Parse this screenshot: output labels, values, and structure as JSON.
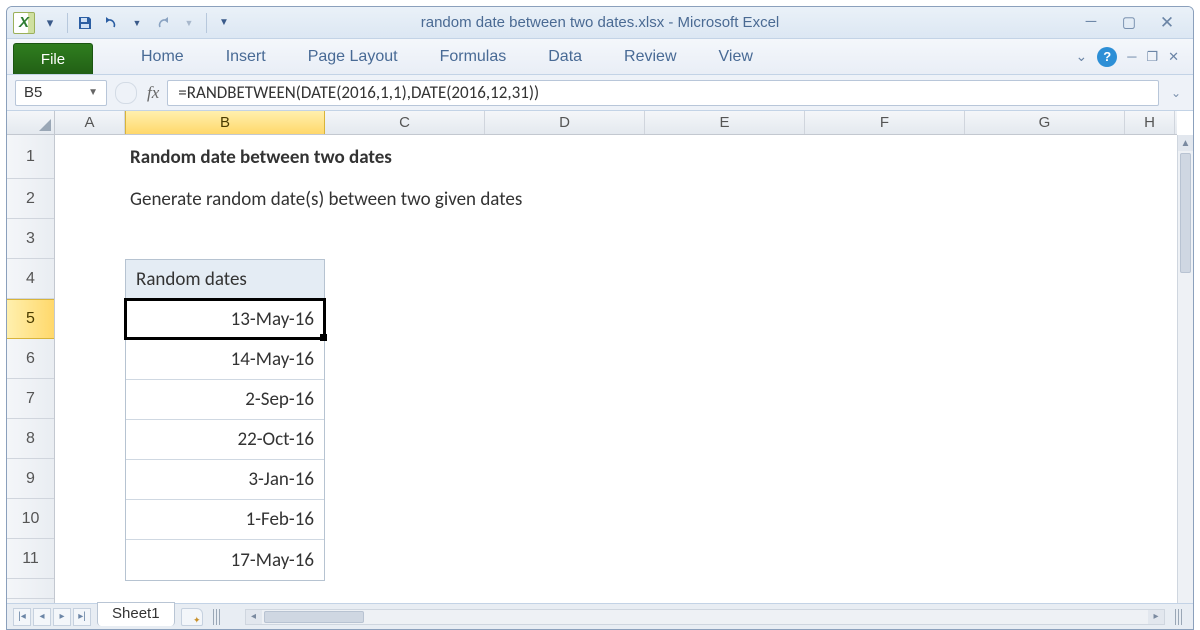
{
  "window": {
    "title": "random date between two dates.xlsx  -  Microsoft Excel"
  },
  "qat": {
    "logo_letter": "X"
  },
  "ribbon": {
    "file": "File",
    "tabs": [
      "Home",
      "Insert",
      "Page Layout",
      "Formulas",
      "Data",
      "Review",
      "View"
    ]
  },
  "name_box": "B5",
  "fx_label": "fx",
  "formula": "=RANDBETWEEN(DATE(2016,1,1),DATE(2016,12,31))",
  "columns": [
    "A",
    "B",
    "C",
    "D",
    "E",
    "F",
    "G",
    "H"
  ],
  "rows": [
    "1",
    "2",
    "3",
    "4",
    "5",
    "6",
    "7",
    "8",
    "9",
    "10",
    "11"
  ],
  "selected_col_index": 1,
  "selected_row_index": 4,
  "content": {
    "title": "Random date between two dates",
    "subtitle": "Generate random date(s) between two given dates",
    "table_header": "Random dates",
    "dates": [
      "13-May-16",
      "14-May-16",
      "2-Sep-16",
      "22-Oct-16",
      "3-Jan-16",
      "1-Feb-16",
      "17-May-16"
    ]
  },
  "sheet": {
    "name": "Sheet1"
  }
}
